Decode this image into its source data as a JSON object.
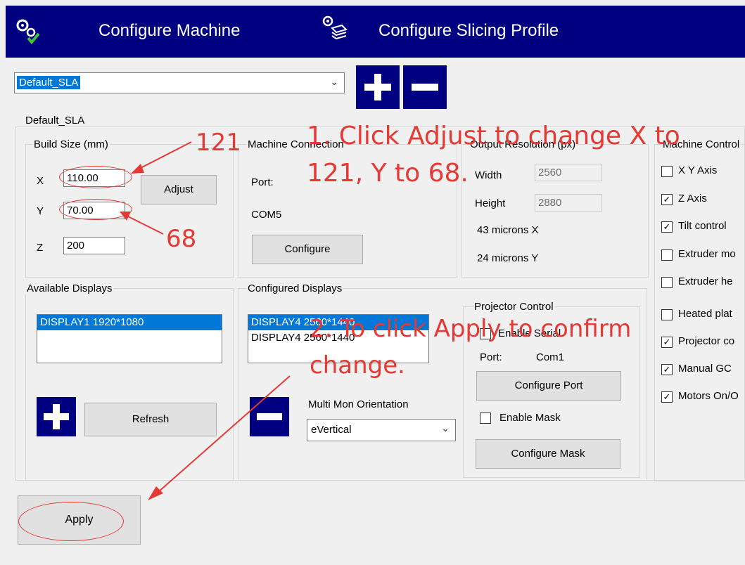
{
  "topbar": {
    "configure_machine": "Configure Machine",
    "configure_slicing": "Configure Slicing Profile"
  },
  "profile": {
    "selected": "Default_SLA"
  },
  "main_group": {
    "title": "Default_SLA"
  },
  "build_size": {
    "title": "Build Size (mm)",
    "x_label": "X",
    "y_label": "Y",
    "z_label": "Z",
    "x_value": "110.00",
    "y_value": "70.00",
    "z_value": "200",
    "adjust_label": "Adjust"
  },
  "machine_connection": {
    "title": "Machine Connection",
    "port_label": "Port:",
    "port_value": "COM5",
    "configure_label": "Configure"
  },
  "output_resolution": {
    "title": "Output Resolution (px)",
    "width_label": "Width",
    "width_value": "2560",
    "height_label": "Height",
    "height_value": "2880",
    "microns_x": "43 microns X",
    "microns_y": "24 microns Y"
  },
  "machine_control": {
    "title": "Machine Control",
    "items": [
      {
        "label": "X Y Axis",
        "checked": false
      },
      {
        "label": "Z Axis",
        "checked": true
      },
      {
        "label": "Tilt control",
        "checked": true
      },
      {
        "label": "Extruder mo",
        "checked": false
      },
      {
        "label": "Extruder he",
        "checked": false
      },
      {
        "label": "Heated plat",
        "checked": false
      },
      {
        "label": "Projector co",
        "checked": true
      },
      {
        "label": "Manual GC",
        "checked": true
      },
      {
        "label": "Motors On/O",
        "checked": true
      }
    ]
  },
  "available_displays": {
    "title": "Available Displays",
    "items": [
      "DISPLAY1 1920*1080"
    ],
    "refresh_label": "Refresh"
  },
  "configured_displays": {
    "title": "Configured Displays",
    "items": [
      "DISPLAY4 2560*1440",
      "DISPLAY4 2560*1440"
    ],
    "multi_mon_label": "Multi Mon Orientation",
    "orientation_value": "eVertical"
  },
  "projector_control": {
    "title": "Projector Control",
    "enable_serial": "Enable Serial",
    "port_label": "Port:",
    "port_value": "Com1",
    "configure_port": "Configure Port",
    "enable_mask": "Enable Mask",
    "configure_mask": "Configure Mask"
  },
  "apply_label": "Apply",
  "annotations": {
    "note1_line1": "1. Click Adjust to change X to",
    "note1_line2": "121, Y to 68.",
    "x_target": "121",
    "y_target": "68",
    "note2_line1": "2. To click Apply to confirm",
    "note2_line2": "change."
  },
  "colors": {
    "accent": "#000080",
    "selection": "#0078d7",
    "annotation": "#e53935"
  }
}
